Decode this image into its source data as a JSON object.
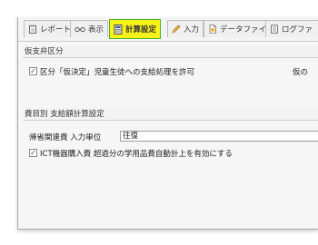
{
  "tabs": [
    {
      "label": "レポート",
      "icon": "clipboard-icon",
      "active": false
    },
    {
      "label": "表示",
      "icon": "glasses-icon",
      "active": false
    },
    {
      "label": "計算設定",
      "icon": "calculator-icon",
      "active": true
    },
    {
      "label": "入力",
      "icon": "pencil-icon",
      "active": false
    },
    {
      "label": "データファイル",
      "icon": "document-icon",
      "active": false
    },
    {
      "label": "ログファ",
      "icon": "log-icon",
      "active": false
    }
  ],
  "sections": {
    "provisional": {
      "title": "仮支弁区分",
      "option_label": "区分「仮決定」児童生徒への支給処理を許可",
      "option_checked": true,
      "right_label": "仮の"
    },
    "expense": {
      "title": "費目別 支給額計算設定",
      "travel_unit_label": "帰省関連費 入力単位",
      "travel_unit_value": "往復",
      "ict_option_label": "ICT機器購入費 超過分の学用品費自動計上を有効にする",
      "ict_option_checked": true
    }
  },
  "colors": {
    "active_tab_bg": "#fbf21a",
    "active_tab_border": "#49b52a"
  }
}
